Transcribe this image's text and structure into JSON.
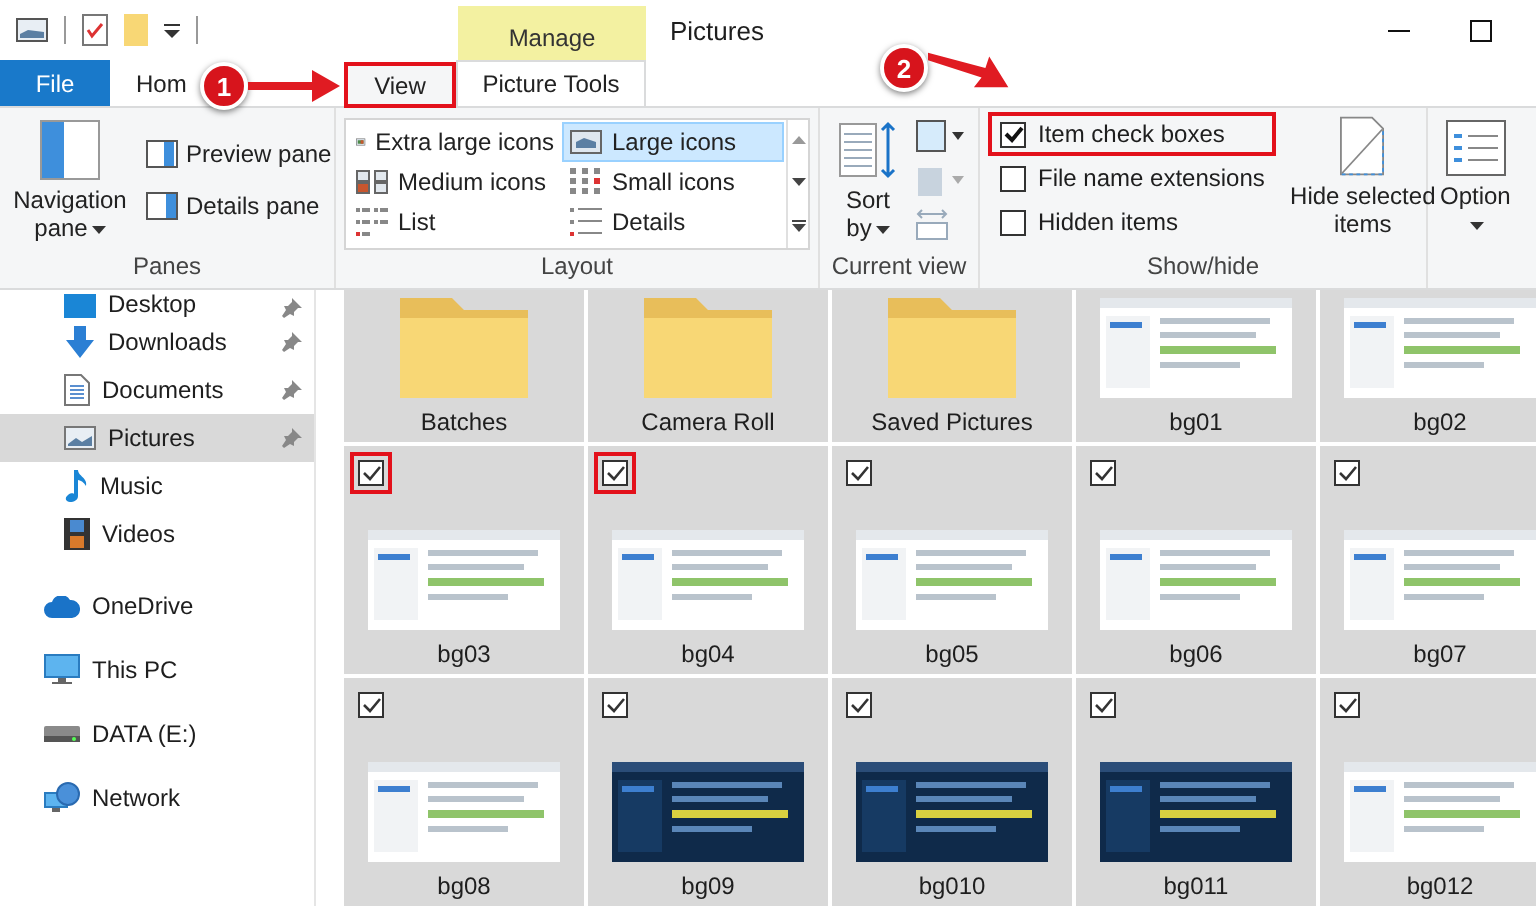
{
  "title_bar": {
    "context_tab": "Manage",
    "title": "Pictures"
  },
  "tabs": [
    {
      "label": "File",
      "kind": "file",
      "selected": false,
      "highlighted": false
    },
    {
      "label": "Hom",
      "kind": "plain",
      "selected": false,
      "highlighted": false
    },
    {
      "label": "View",
      "kind": "plain",
      "selected": true,
      "highlighted": true
    },
    {
      "label": "Picture Tools",
      "kind": "context",
      "selected": false,
      "highlighted": false
    }
  ],
  "ribbon": {
    "panes": {
      "label": "Panes",
      "navigation_pane": "Navigation pane",
      "buttons": [
        "Preview pane",
        "Details pane"
      ]
    },
    "layout": {
      "label": "Layout",
      "options": [
        {
          "label": "Extra large icons",
          "selected": false
        },
        {
          "label": "Large icons",
          "selected": true
        },
        {
          "label": "Medium icons",
          "selected": false
        },
        {
          "label": "Small icons",
          "selected": false
        },
        {
          "label": "List",
          "selected": false
        },
        {
          "label": "Details",
          "selected": false
        }
      ]
    },
    "current_view": {
      "label": "Current view",
      "sort_by": "Sort by"
    },
    "show_hide": {
      "label": "Show/hide",
      "checkboxes": [
        {
          "label": "Item check boxes",
          "checked": true,
          "highlighted": true
        },
        {
          "label": "File name extensions",
          "checked": false,
          "highlighted": false
        },
        {
          "label": "Hidden items",
          "checked": false,
          "highlighted": false
        }
      ],
      "hide_selected": "Hide selected items"
    },
    "options": {
      "label": "Option"
    }
  },
  "navigation": {
    "quick_access": [
      {
        "label": "Desktop",
        "pinned": true,
        "selected": false
      },
      {
        "label": "Downloads",
        "pinned": true,
        "selected": false
      },
      {
        "label": "Documents",
        "pinned": true,
        "selected": false
      },
      {
        "label": "Pictures",
        "pinned": true,
        "selected": true
      },
      {
        "label": "Music",
        "pinned": false,
        "selected": false
      },
      {
        "label": "Videos",
        "pinned": false,
        "selected": false
      }
    ],
    "locations": [
      {
        "label": "OneDrive",
        "selected": false
      },
      {
        "label": "This PC",
        "selected": false
      },
      {
        "label": "DATA (E:)",
        "selected": false
      },
      {
        "label": "Network",
        "selected": false
      }
    ]
  },
  "items": [
    {
      "name": "Batches",
      "kind": "folder"
    },
    {
      "name": "Camera Roll",
      "kind": "folder"
    },
    {
      "name": "Saved Pictures",
      "kind": "folder"
    },
    {
      "name": "bg01",
      "kind": "picture"
    },
    {
      "name": "bg02",
      "kind": "picture"
    },
    {
      "name": "bg03",
      "kind": "picture",
      "checked": true,
      "highlighted": true
    },
    {
      "name": "bg04",
      "kind": "picture",
      "checked": true,
      "highlighted": true
    },
    {
      "name": "bg05",
      "kind": "picture",
      "checked": true,
      "highlighted": false
    },
    {
      "name": "bg06",
      "kind": "picture",
      "checked": true,
      "highlighted": false
    },
    {
      "name": "bg07",
      "kind": "picture",
      "checked": true,
      "highlighted": false
    },
    {
      "name": "bg08",
      "kind": "picture",
      "checked": true,
      "highlighted": false
    },
    {
      "name": "bg09",
      "kind": "picture",
      "checked": true,
      "highlighted": false
    },
    {
      "name": "bg010",
      "kind": "picture",
      "checked": true,
      "highlighted": false
    },
    {
      "name": "bg011",
      "kind": "picture",
      "checked": true,
      "highlighted": false
    },
    {
      "name": "bg012",
      "kind": "picture",
      "checked": true,
      "highlighted": false
    }
  ],
  "annotations": [
    {
      "label": "1"
    },
    {
      "label": "2"
    }
  ]
}
